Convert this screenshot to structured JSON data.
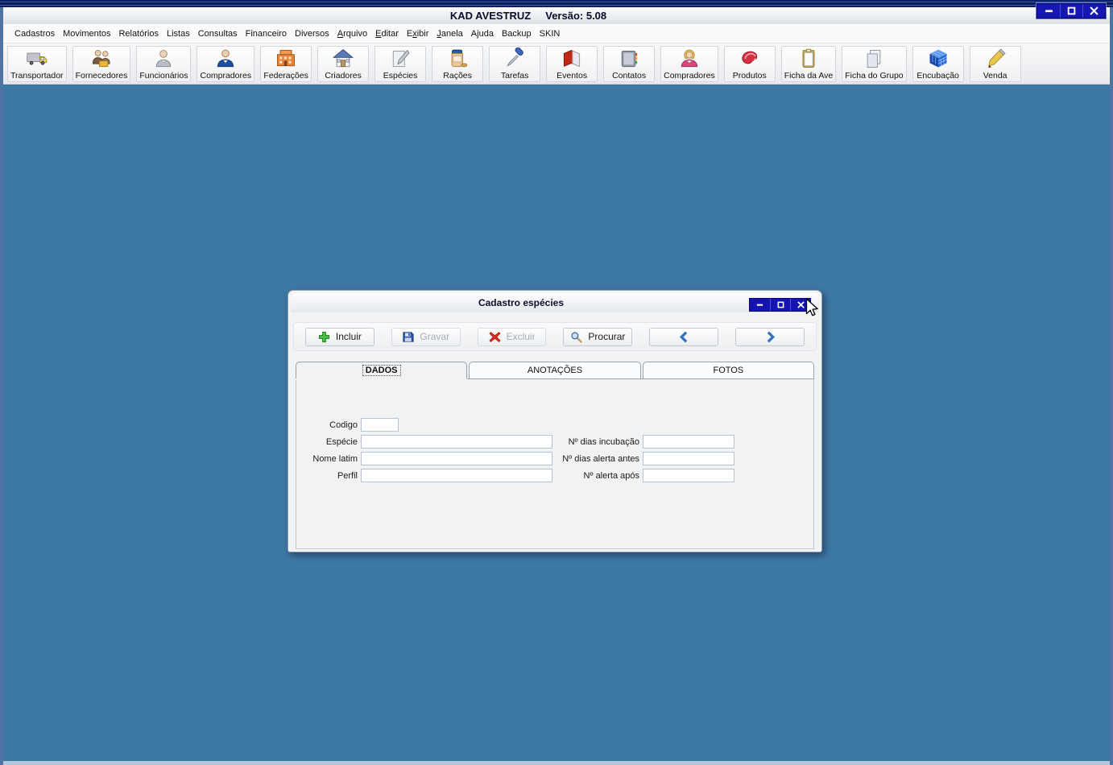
{
  "window": {
    "title": "KAD AVESTRUZ",
    "version_label": "Versão: 5.08",
    "controls": [
      {
        "icon": "minimize-icon"
      },
      {
        "icon": "maximize-icon"
      },
      {
        "icon": "close-icon"
      }
    ]
  },
  "menu": {
    "items": [
      {
        "label": "Cadastros"
      },
      {
        "label": "Movimentos"
      },
      {
        "label": "Relatórios"
      },
      {
        "label": "Listas"
      },
      {
        "label": "Consultas"
      },
      {
        "label": "Financeiro"
      },
      {
        "label": "Diversos"
      },
      {
        "label": "Arquivo",
        "accel": 0
      },
      {
        "label": "Editar",
        "accel": 0
      },
      {
        "label": "Exibir",
        "accel": 1
      },
      {
        "label": "Janela",
        "accel": 0
      },
      {
        "label": "Ajuda"
      },
      {
        "label": "Backup"
      },
      {
        "label": "SKIN"
      }
    ]
  },
  "toolbar": {
    "buttons": [
      {
        "label": "Transportador",
        "icon": "truck-icon"
      },
      {
        "label": "Fornecedores",
        "icon": "suppliers-people-icon"
      },
      {
        "label": "Funcionários",
        "icon": "employee-person-icon"
      },
      {
        "label": "Compradores",
        "icon": "buyer-person-icon"
      },
      {
        "label": "Federações",
        "icon": "federation-building-icon"
      },
      {
        "label": "Criadores",
        "icon": "breeder-house-icon"
      },
      {
        "label": "Espécies",
        "icon": "species-notepad-icon"
      },
      {
        "label": "Rações",
        "icon": "feed-jar-icon"
      },
      {
        "label": "Tarefas",
        "icon": "tasks-screwdriver-icon"
      },
      {
        "label": "Eventos",
        "icon": "events-book-icon"
      },
      {
        "label": "Contatos",
        "icon": "contacts-book-icon"
      },
      {
        "label": "Compradores",
        "icon": "buyer-woman-icon"
      },
      {
        "label": "Produtos",
        "icon": "products-meat-icon"
      },
      {
        "label": "Ficha da Ave",
        "icon": "bird-record-clipboard-icon"
      },
      {
        "label": "Ficha do Grupo",
        "icon": "group-record-pages-icon"
      },
      {
        "label": "Encubação",
        "icon": "incubation-cube-icon"
      },
      {
        "label": "Venda",
        "icon": "sale-pencil-icon"
      }
    ]
  },
  "dialog": {
    "title": "Cadastro espécies",
    "controls": [
      {
        "icon": "minimize-icon"
      },
      {
        "icon": "maximize-icon"
      },
      {
        "icon": "close-icon"
      }
    ],
    "actions": [
      {
        "label": "Incluir",
        "icon": "add-plus-icon",
        "enabled": true
      },
      {
        "label": "Gravar",
        "icon": "save-disk-icon",
        "enabled": false
      },
      {
        "label": "Excluir",
        "icon": "delete-x-icon",
        "enabled": false
      },
      {
        "label": "Procurar",
        "icon": "search-magnifier-icon",
        "enabled": true
      },
      {
        "label": "",
        "icon": "prev-arrow-icon",
        "enabled": true
      },
      {
        "label": "",
        "icon": "next-arrow-icon",
        "enabled": true
      }
    ],
    "tabs": [
      {
        "label": "DADOS",
        "active": true
      },
      {
        "label": "ANOTAÇÕES",
        "active": false
      },
      {
        "label": "FOTOS",
        "active": false
      }
    ],
    "form": {
      "left_fields": [
        {
          "label": "Codigo",
          "value": "",
          "short": true
        },
        {
          "label": "Espécie",
          "value": ""
        },
        {
          "label": "Nome latim",
          "value": ""
        },
        {
          "label": "Perfil",
          "value": ""
        }
      ],
      "right_fields": [
        {
          "label": "Nº dias incubação",
          "value": ""
        },
        {
          "label": "Nº dias alerta antes",
          "value": ""
        },
        {
          "label": "Nº alerta após",
          "value": ""
        }
      ]
    }
  },
  "colors": {
    "desktop_background": "#3d77a4",
    "titlebar_navy": "#0d2166",
    "control_button_blue": "#1515b2",
    "chevron_blue": "#2f73c0",
    "disabled_text": "#a8acb2"
  }
}
